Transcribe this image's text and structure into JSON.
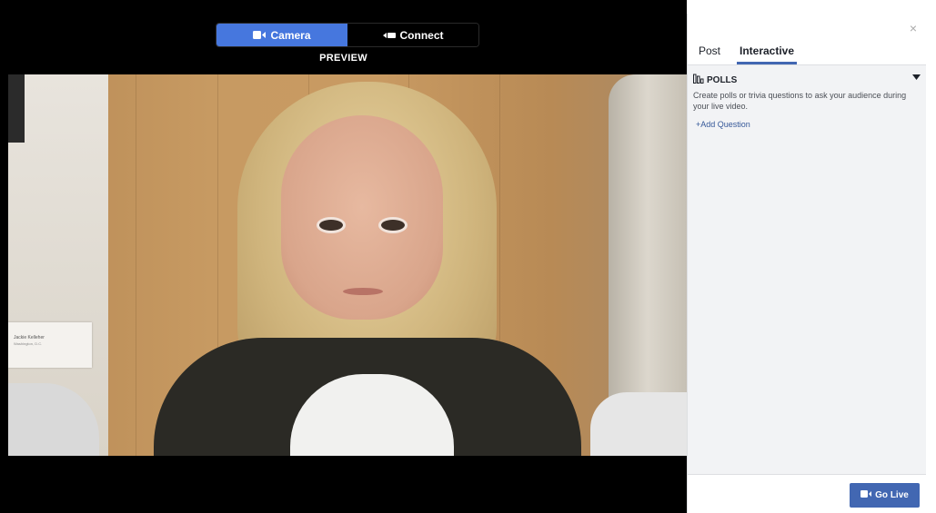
{
  "source_tabs": [
    {
      "label": "Camera",
      "icon": "video-camera-icon",
      "active": true
    },
    {
      "label": "Connect",
      "icon": "connect-plug-icon",
      "active": false
    }
  ],
  "preview_label": "PREVIEW",
  "video": {
    "name_card_line1": "Jackie Kelleher",
    "name_card_line2": "Washington, D.C."
  },
  "panel": {
    "close_icon": "×",
    "tabs": [
      {
        "label": "Post",
        "active": false
      },
      {
        "label": "Interactive",
        "active": true
      }
    ],
    "polls": {
      "title": "POLLS",
      "description": "Create polls or trivia questions to ask your audience during your live video.",
      "add_question": "+Add Question"
    },
    "go_live_label": "Go Live"
  },
  "colors": {
    "camera_tab": "#4677de",
    "go_live": "#4267b2",
    "link": "#365899"
  }
}
